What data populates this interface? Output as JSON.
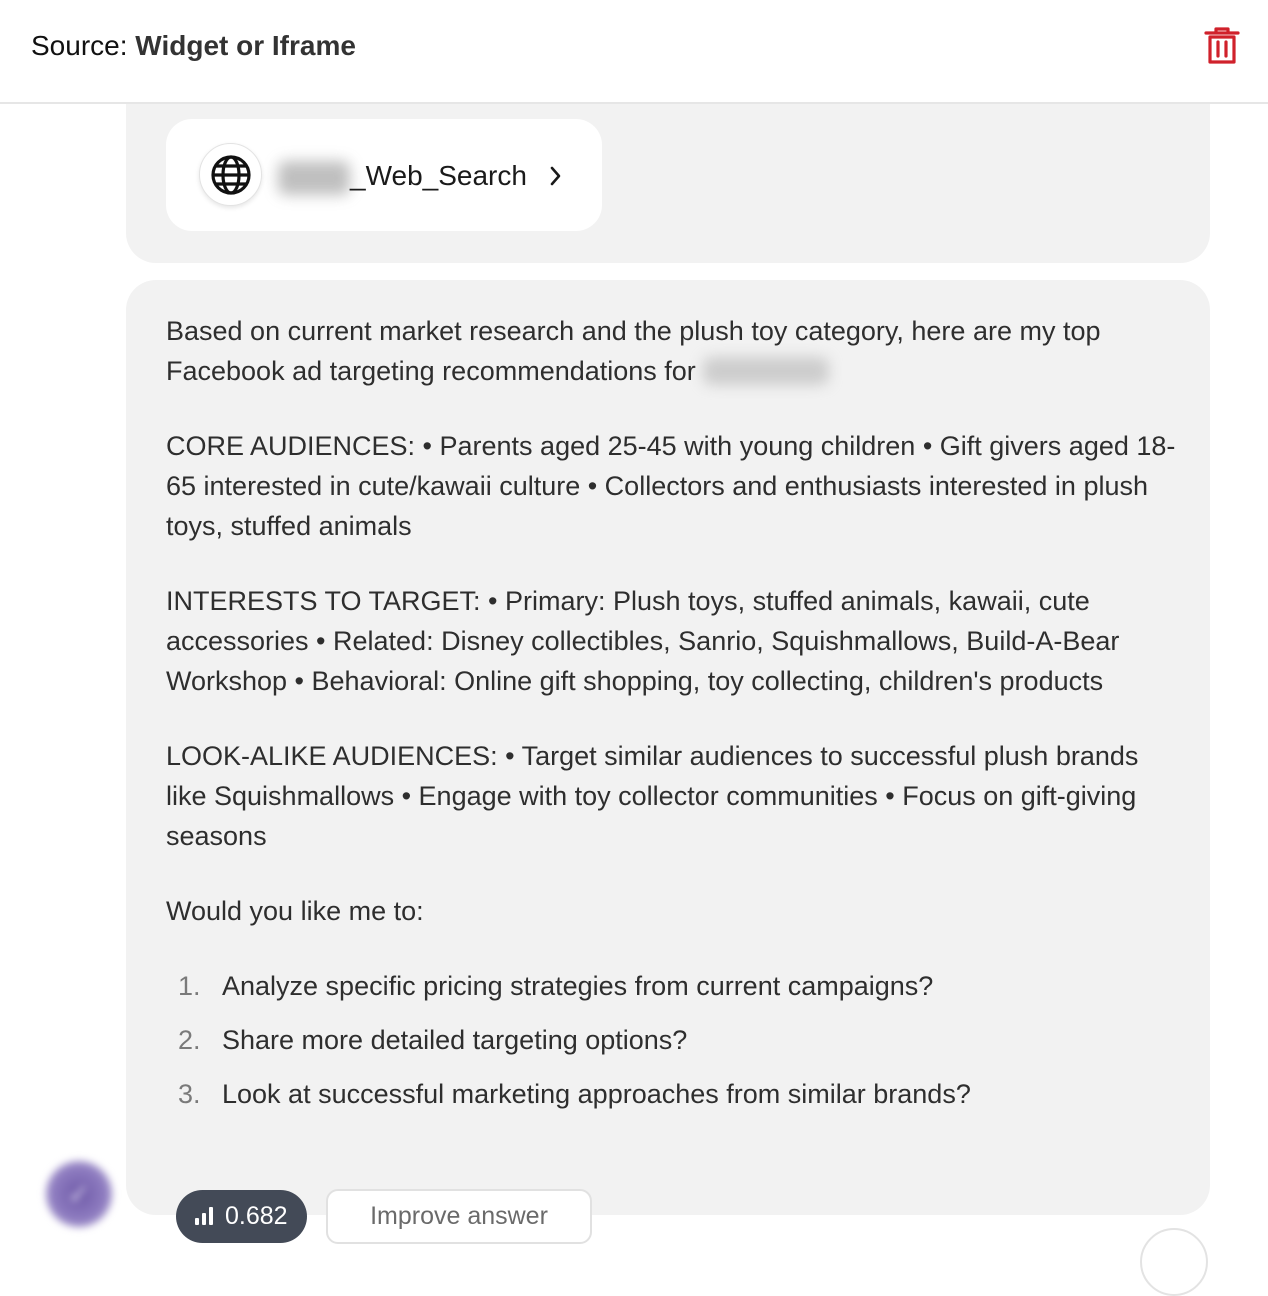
{
  "header": {
    "source_label": "Source: ",
    "source_value": "Widget or Iframe",
    "delete_icon": "trash-icon"
  },
  "colors": {
    "accent_red": "#d0212b",
    "card_bg": "#f2f2f2",
    "score_pill_bg": "#434a57"
  },
  "tool": {
    "icon": "globe-icon",
    "name_visible": "_Web_Search"
  },
  "answer": {
    "intro": "Based on current market research and the plush toy category, here are my top Facebook ad targeting recommendations for",
    "core": "CORE AUDIENCES: • Parents aged 25-45 with young children • Gift givers aged 18-65 interested in cute/kawaii culture • Collectors and enthusiasts interested in plush toys, stuffed animals",
    "interests": "INTERESTS TO TARGET: • Primary: Plush toys, stuffed animals, kawaii, cute accessories • Related: Disney collectibles, Sanrio, Squishmallows, Build-A-Bear Workshop • Behavioral: Online gift shopping, toy collecting, children's products",
    "lookalike": "LOOK-ALIKE AUDIENCES: • Target similar audiences to successful plush brands like Squishmallows • Engage with toy collector communities • Focus on gift-giving seasons",
    "question": "Would you like me to:",
    "options": [
      {
        "num": "1.",
        "text": "Analyze specific pricing strategies from current campaigns?"
      },
      {
        "num": "2.",
        "text": "Share more detailed targeting options?"
      },
      {
        "num": "3.",
        "text": "Look at successful marketing approaches from similar brands?"
      }
    ]
  },
  "footer": {
    "score_icon": "signal-bars-icon",
    "score": "0.682",
    "improve_label": "Improve answer"
  }
}
